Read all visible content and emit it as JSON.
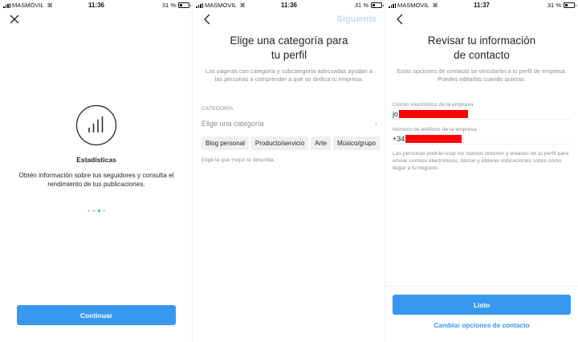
{
  "status_bar": {
    "carrier": "MASMOVIL",
    "battery": "31 %",
    "times": [
      "11:36",
      "11:36",
      "11:37"
    ]
  },
  "screen1": {
    "close_icon": "close-icon",
    "title": "Estadísticas",
    "description": "Obtén información sobre tus seguidores y consulta el rendimiento de tus publicaciones.",
    "pager": {
      "count": 4,
      "active_index": 2
    },
    "continue_label": "Continuar"
  },
  "screen2": {
    "back_icon": "chevron-left-icon",
    "next_label": "Siguiente",
    "title_line1": "Elige una categoría para",
    "title_line2": "tu perfil",
    "subtitle": "Las páginas con categoría y subcategoría adecuadas ayudan a las personas a comprender a qué se dedica tu empresa.",
    "category_label": "CATEGORÍA",
    "category_placeholder": "Elige una categoría",
    "chips": [
      "Blog personal",
      "Producto/servicio",
      "Arte",
      "Músico/grupo"
    ],
    "hint": "Elige la que mejor te describa."
  },
  "screen3": {
    "back_icon": "chevron-left-icon",
    "title_line1": "Revisar tu información",
    "title_line2": "de contacto",
    "subtitle": "Estas opciones de contacto se vincularán a tu perfil de empresa. Puedes editarlas cuando quieras.",
    "email_label": "Correo electrónico de la empresa",
    "email_value": "jo",
    "phone_label": "Número de teléfono de la empresa",
    "phone_value": "+34",
    "note": "Las personas podrán usar los nuevos botones y enlaces de tu perfil para enviar correos electrónicos, llamar y obtener indicaciones sobre cómo llegar a tu negocio.",
    "done_label": "Listo",
    "change_label": "Cambiar opciones de contacto"
  },
  "colors": {
    "accent": "#3897f0",
    "accent_disabled": "#c7daf1",
    "redaction": "#ff0000",
    "text_primary": "#262626",
    "text_secondary": "#8e8e8e"
  }
}
